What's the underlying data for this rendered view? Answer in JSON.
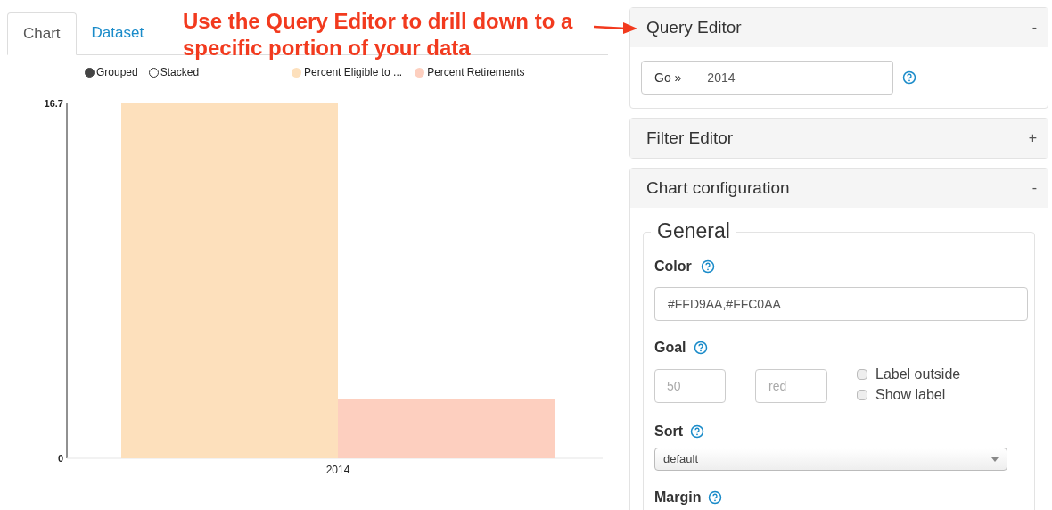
{
  "tabs": [
    {
      "label": "Chart",
      "selected": true
    },
    {
      "label": "Dataset",
      "selected": false
    }
  ],
  "annotation": "Use the Query Editor to drill down to a specific portion of your data",
  "chart_mode": [
    {
      "label": "Grouped",
      "selected": true
    },
    {
      "label": "Stacked",
      "selected": false
    }
  ],
  "chart_data": {
    "type": "bar",
    "legend": "top",
    "categories": [
      "2014"
    ],
    "ylim": [
      0,
      16.7
    ],
    "yticks": [
      0,
      16.7
    ],
    "series": [
      {
        "name": "Percent Eligible to ...",
        "color": "#fde0bc",
        "values": [
          16.7
        ]
      },
      {
        "name": "Percent Retirements",
        "color": "#fdcfbf",
        "values": [
          2.8
        ]
      }
    ]
  },
  "query_editor": {
    "title": "Query Editor",
    "toggle": "-",
    "go_button": "Go »",
    "value": "2014"
  },
  "filter_editor": {
    "title": "Filter Editor",
    "toggle": "+"
  },
  "chart_configuration": {
    "title": "Chart configuration",
    "toggle": "-",
    "section": "General",
    "color": {
      "label": "Color",
      "value": "#FFD9AA,#FFC0AA"
    },
    "goal": {
      "label": "Goal",
      "value_placeholder": "50",
      "color_placeholder": "red",
      "options": [
        {
          "label": "Label outside",
          "checked": false
        },
        {
          "label": "Show label",
          "checked": false
        }
      ]
    },
    "sort": {
      "label": "Sort",
      "value": "default"
    },
    "margin": {
      "label": "Margin"
    }
  }
}
